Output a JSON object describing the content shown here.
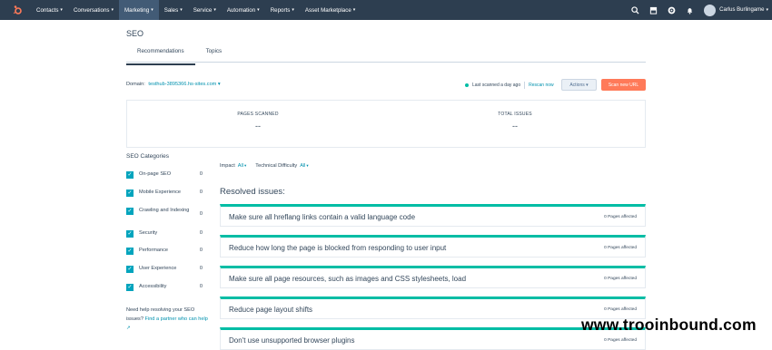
{
  "topnav": {
    "items": [
      {
        "label": "Contacts",
        "active": false
      },
      {
        "label": "Conversations",
        "active": false
      },
      {
        "label": "Marketing",
        "active": true
      },
      {
        "label": "Sales",
        "active": false
      },
      {
        "label": "Service",
        "active": false
      },
      {
        "label": "Automation",
        "active": false
      },
      {
        "label": "Reports",
        "active": false
      },
      {
        "label": "Asset Marketplace",
        "active": false
      }
    ],
    "icons": [
      "search-icon",
      "marketplace-icon",
      "settings-icon",
      "notifications-icon"
    ],
    "user_name": "Carlus Burlingame"
  },
  "page": {
    "title": "SEO"
  },
  "tabs": [
    {
      "label": "Recommendations",
      "active": true
    },
    {
      "label": "Topics",
      "active": false
    }
  ],
  "domain": {
    "label": "Domain:",
    "value": "testhub-3895366.hs-sites.com"
  },
  "scan": {
    "status": "Last scanned a day ago",
    "rescan": "Rescan now",
    "actions": "Actions",
    "scan_new": "Scan new URL",
    "status_color": "#00bda5"
  },
  "stats": [
    {
      "label": "PAGES SCANNED",
      "value": "--"
    },
    {
      "label": "TOTAL ISSUES",
      "value": "--"
    }
  ],
  "categories": {
    "title": "SEO Categories",
    "items": [
      {
        "label": "On-page SEO",
        "count": "0",
        "checked": true
      },
      {
        "label": "Mobile Experience",
        "count": "0",
        "checked": true
      },
      {
        "label": "Crawling and Indexing",
        "count": "0",
        "checked": true
      },
      {
        "label": "Security",
        "count": "0",
        "checked": true
      },
      {
        "label": "Performance",
        "count": "0",
        "checked": true
      },
      {
        "label": "User Experience",
        "count": "0",
        "checked": true
      },
      {
        "label": "Accessibility",
        "count": "0",
        "checked": true
      }
    ],
    "help_text": "Need help resolving your SEO issues?",
    "help_link": "Find a partner who can help"
  },
  "filters": {
    "impact_label": "Impact",
    "impact_value": "All",
    "difficulty_label": "Technical Difficulty",
    "difficulty_value": "All"
  },
  "resolved": {
    "title": "Resolved issues:",
    "items": [
      {
        "title": "Make sure all hreflang links contain a valid language code",
        "count": "0 Pages affected"
      },
      {
        "title": "Reduce how long the page is blocked from responding to user input",
        "count": "0 Pages affected"
      },
      {
        "title": "Make sure all page resources, such as images and CSS stylesheets, load",
        "count": "0 Pages affected"
      },
      {
        "title": "Reduce page layout shifts",
        "count": "0 Pages affected"
      },
      {
        "title": "Don't use unsupported browser plugins",
        "count": "0 Pages affected"
      }
    ]
  },
  "watermark": "www.trooinbound.com",
  "colors": {
    "nav_bg": "#2d3e50",
    "accent_teal": "#00bda5",
    "link": "#0091ae",
    "primary_button": "#ff7a59",
    "text": "#33475b"
  }
}
